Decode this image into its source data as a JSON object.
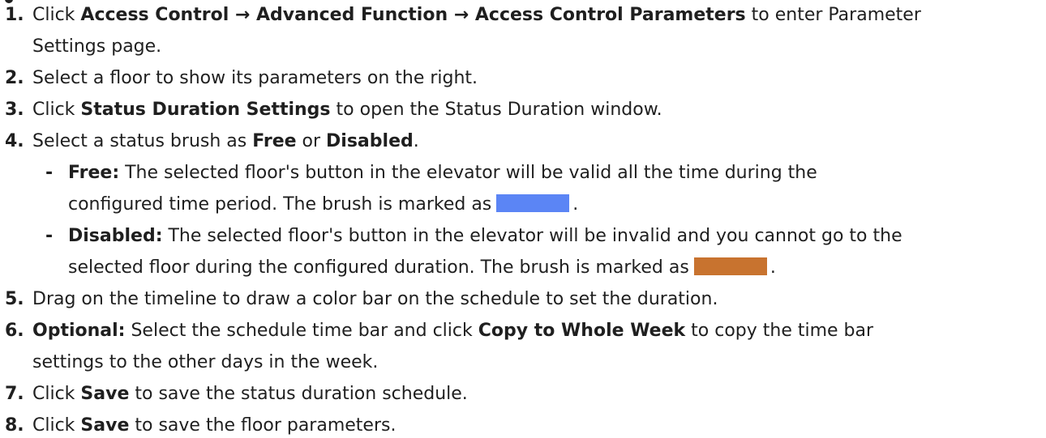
{
  "steps": [
    {
      "num": "1.",
      "lines": [
        {
          "parts": [
            {
              "t": "Click ",
              "b": false
            },
            {
              "t": "Access Control → Advanced Function → Access Control Parameters",
              "b": true
            },
            {
              "t": " to enter Parameter",
              "b": false
            }
          ]
        },
        {
          "parts": [
            {
              "t": "Settings page.",
              "b": false
            }
          ]
        }
      ]
    },
    {
      "num": "2.",
      "lines": [
        {
          "parts": [
            {
              "t": "Select a floor to show its parameters on the right.",
              "b": false
            }
          ]
        }
      ]
    },
    {
      "num": "3.",
      "lines": [
        {
          "parts": [
            {
              "t": "Click ",
              "b": false
            },
            {
              "t": "Status Duration Settings",
              "b": true
            },
            {
              "t": " to open the Status Duration window.",
              "b": false
            }
          ]
        }
      ]
    },
    {
      "num": "4.",
      "lines": [
        {
          "parts": [
            {
              "t": "Select a status brush as ",
              "b": false
            },
            {
              "t": "Free",
              "b": true
            },
            {
              "t": " or ",
              "b": false
            },
            {
              "t": "Disabled",
              "b": true
            },
            {
              "t": ".",
              "b": false
            }
          ]
        }
      ],
      "subitems": [
        {
          "dash": "-",
          "lines": [
            {
              "parts": [
                {
                  "t": "Free:",
                  "b": true
                },
                {
                  "t": " The selected floor's button in the elevator will be valid all the time during the",
                  "b": false
                }
              ]
            },
            {
              "parts": [
                {
                  "t": "configured time period. The brush is marked as",
                  "b": false
                }
              ],
              "swatch": "free",
              "after": "."
            }
          ]
        },
        {
          "dash": "-",
          "lines": [
            {
              "parts": [
                {
                  "t": "Disabled:",
                  "b": true
                },
                {
                  "t": " The selected floor's button in the elevator will be invalid and you cannot go to the",
                  "b": false
                }
              ]
            },
            {
              "parts": [
                {
                  "t": "selected floor during the configured duration. The brush is marked as",
                  "b": false
                }
              ],
              "swatch": "disabled",
              "after": "."
            }
          ]
        }
      ]
    },
    {
      "num": "5.",
      "lines": [
        {
          "parts": [
            {
              "t": "Drag on the timeline to draw a color bar on the schedule to set the duration.",
              "b": false
            }
          ]
        }
      ]
    },
    {
      "num": "6.",
      "lines": [
        {
          "parts": [
            {
              "t": "Optional:",
              "b": true
            },
            {
              "t": " Select the schedule time bar and click ",
              "b": false
            },
            {
              "t": "Copy to Whole Week",
              "b": true
            },
            {
              "t": " to copy the time bar",
              "b": false
            }
          ]
        },
        {
          "parts": [
            {
              "t": "settings to the other days in the week.",
              "b": false
            }
          ]
        }
      ]
    },
    {
      "num": "7.",
      "lines": [
        {
          "parts": [
            {
              "t": "Click ",
              "b": false
            },
            {
              "t": "Save",
              "b": true
            },
            {
              "t": " to save the status duration schedule.",
              "b": false
            }
          ]
        }
      ]
    },
    {
      "num": "8.",
      "lines": [
        {
          "parts": [
            {
              "t": "Click ",
              "b": false
            },
            {
              "t": "Save",
              "b": true
            },
            {
              "t": " to save the floor parameters.",
              "b": false
            }
          ]
        }
      ]
    }
  ],
  "colors": {
    "free": "#5b85f5",
    "disabled": "#c8732f"
  }
}
